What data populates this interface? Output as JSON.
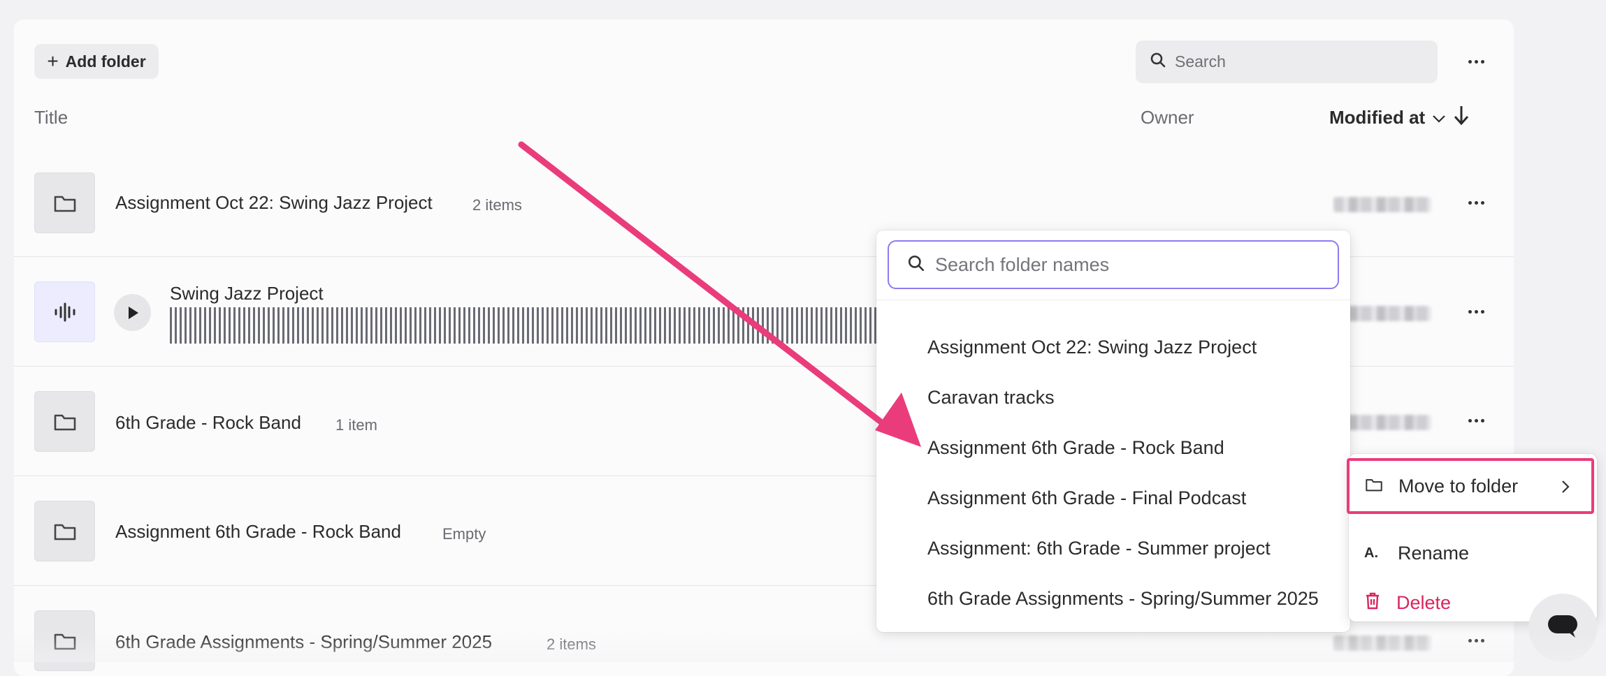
{
  "toolbar": {
    "add_folder_label": "Add folder",
    "search_placeholder": "Search"
  },
  "columns": {
    "title": "Title",
    "owner": "Owner",
    "modified": "Modified at"
  },
  "rows": [
    {
      "title": "Assignment Oct 22: Swing Jazz Project",
      "meta": "2 items",
      "type": "folder"
    },
    {
      "title": "Swing Jazz Project",
      "meta": "",
      "type": "audio"
    },
    {
      "title": "6th Grade - Rock Band",
      "meta": "1 item",
      "type": "folder"
    },
    {
      "title": "Assignment 6th Grade - Rock Band",
      "meta": "Empty",
      "type": "folder"
    },
    {
      "title": "6th Grade Assignments - Spring/Summer 2025",
      "meta": "2 items",
      "type": "folder"
    }
  ],
  "move_dropdown": {
    "search_placeholder": "Search folder names",
    "folders": [
      "Assignment Oct 22: Swing Jazz Project",
      "Caravan tracks",
      "Assignment 6th Grade - Rock Band",
      "Assignment 6th Grade - Final Podcast",
      "Assignment: 6th Grade - Summer project",
      "6th Grade Assignments - Spring/Summer 2025"
    ]
  },
  "context_menu": {
    "move": "Move to folder",
    "rename": "Rename",
    "delete": "Delete"
  },
  "colors": {
    "annotation": "#ea3c7b",
    "delete": "#d9265e",
    "focus": "#8b7cf0"
  }
}
